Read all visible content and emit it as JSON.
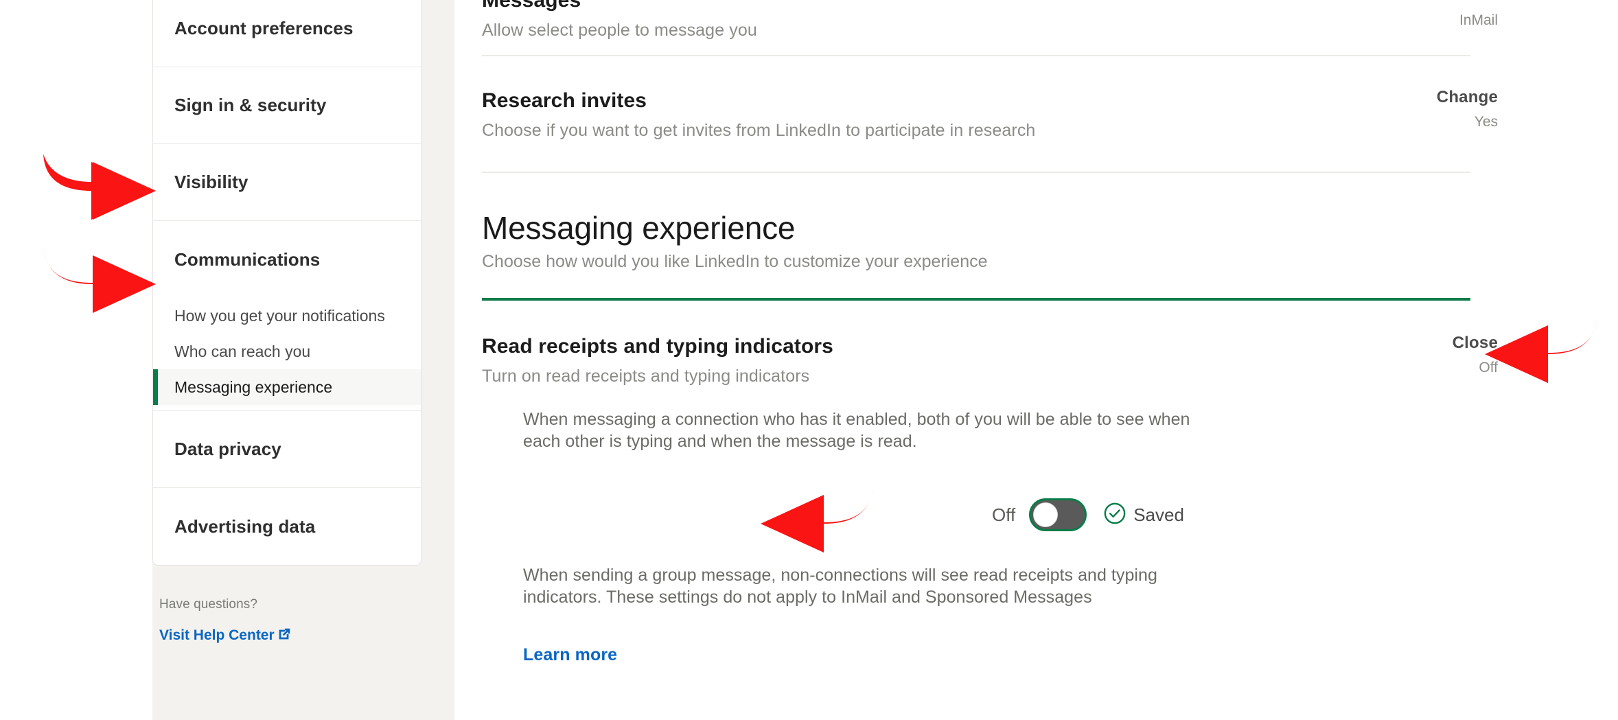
{
  "colors": {
    "accent_green": "#0a7d49",
    "link_blue": "#0a66c2",
    "annotation_red": "#fa1414",
    "page_bg": "#f3f2ef"
  },
  "sidebar": {
    "items": [
      {
        "label": "Account preferences"
      },
      {
        "label": "Sign in & security"
      },
      {
        "label": "Visibility"
      },
      {
        "label": "Communications"
      },
      {
        "label": "Data privacy"
      },
      {
        "label": "Advertising data"
      }
    ],
    "sub_items": [
      {
        "label": "How you get your notifications",
        "active": false
      },
      {
        "label": "Who can reach you",
        "active": false
      },
      {
        "label": "Messaging experience",
        "active": true
      }
    ],
    "help": {
      "question": "Have questions?",
      "link_label": "Visit Help Center",
      "link_icon": "external-link-icon"
    }
  },
  "main": {
    "messages_row": {
      "title": "Messages",
      "subtitle": "Allow select people to message you",
      "value": "InMail"
    },
    "research_row": {
      "title": "Research invites",
      "subtitle": "Choose if you want to get invites from LinkedIn to participate in research",
      "action": "Change",
      "value": "Yes"
    },
    "section": {
      "heading": "Messaging experience",
      "subheading": "Choose how would you like LinkedIn to customize your experience"
    },
    "read_receipts": {
      "title": "Read receipts and typing indicators",
      "subtitle": "Turn on read receipts and typing indicators",
      "action": "Close",
      "value": "Off",
      "description_top": "When messaging a connection who has it enabled, both of you will be able to see when each other is typing and when the message is read.",
      "toggle_label": "Off",
      "toggle_state": "off",
      "saved_label": "Saved",
      "saved_icon": "check-circle-icon",
      "description_bottom": "When sending a group message, non-connections will see read receipts and typing indicators. These settings do not apply to InMail and Sponsored Messages",
      "learn_more_label": "Learn more"
    }
  },
  "annotations": [
    {
      "name": "arrow-communications",
      "direction": "right"
    },
    {
      "name": "arrow-messaging-experience",
      "direction": "right"
    },
    {
      "name": "arrow-saved",
      "direction": "left"
    },
    {
      "name": "arrow-close",
      "direction": "left"
    }
  ]
}
